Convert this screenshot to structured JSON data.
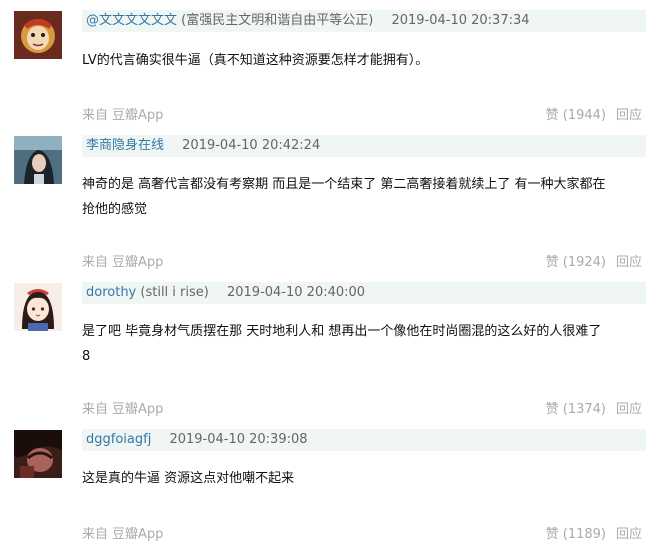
{
  "comments": [
    {
      "username": "@文文文文文文",
      "signature": "(富强民主文明和谐自由平等公正)",
      "time": "2019-04-10 20:37:34",
      "lines": [
        "LV的代言确实很牛逼（真不知道这种资源要怎样才能拥有）。"
      ],
      "source_label": "来自",
      "source_app": "豆瓣App",
      "vote": "赞 (1944)",
      "reply": "回应"
    },
    {
      "username": "李商隐身在线",
      "signature": "",
      "time": "2019-04-10 20:42:24",
      "lines": [
        "神奇的是 高奢代言都没有考察期 而且是一个结束了 第二高奢接着就续上了 有一种大家都在",
        "抢他的感觉"
      ],
      "source_label": "来自",
      "source_app": "豆瓣App",
      "vote": "赞 (1924)",
      "reply": "回应"
    },
    {
      "username": "dorothy",
      "signature": "(still i rise)",
      "time": "2019-04-10 20:40:00",
      "lines": [
        "是了吧 毕竟身材气质摆在那 天时地利人和 想再出一个像他在时尚圈混的这么好的人很难了",
        "8"
      ],
      "source_label": "来自",
      "source_app": "豆瓣App",
      "vote": "赞 (1374)",
      "reply": "回应"
    },
    {
      "username": "dggfoiagfj",
      "signature": "",
      "time": "2019-04-10 20:39:08",
      "lines": [
        "这是真的牛逼 资源这点对他嘲不起来"
      ],
      "source_label": "来自",
      "source_app": "豆瓣App",
      "vote": "赞 (1189)",
      "reply": "回应"
    }
  ]
}
